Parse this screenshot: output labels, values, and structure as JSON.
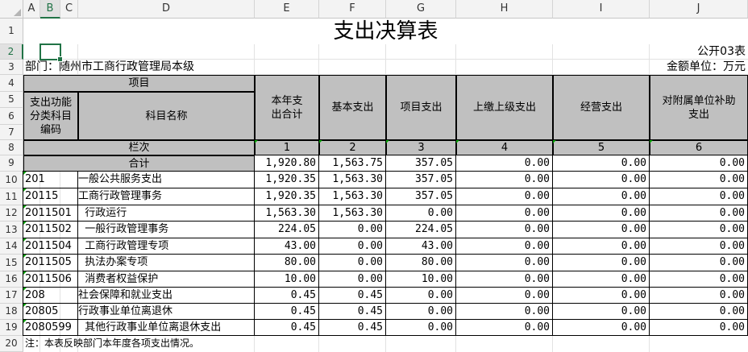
{
  "columns": [
    "A",
    "B",
    "C",
    "D",
    "E",
    "F",
    "G",
    "H",
    "I",
    "J"
  ],
  "rows": [
    "1",
    "2",
    "3",
    "4",
    "5",
    "6",
    "7",
    "8",
    "9",
    "10",
    "11",
    "12",
    "13",
    "14",
    "15",
    "16",
    "17",
    "18",
    "19",
    "20"
  ],
  "title": "支出决算表",
  "form_no": "公开03表",
  "dept": "部门：随州市工商行政管理局本级",
  "unit": "金额单位：万元",
  "headers": {
    "item": "项目",
    "code": "支出功能分类科目编码",
    "name": "科目名称",
    "total": "本年支出合计",
    "basic": "基本支出",
    "project": "项目支出",
    "upper": "上缴上级支出",
    "business": "经营支出",
    "subsidy": "对附属单位补助支出",
    "seq_label": "栏次",
    "seq": [
      "1",
      "2",
      "3",
      "4",
      "5",
      "6"
    ],
    "sum_label": "合计"
  },
  "total_row": [
    "1,920.80",
    "1,563.75",
    "357.05",
    "0.00",
    "0.00",
    "0.00"
  ],
  "data_rows": [
    {
      "code": "201",
      "name": "一般公共服务支出",
      "vals": [
        "1,920.35",
        "1,563.30",
        "357.05",
        "0.00",
        "0.00",
        "0.00"
      ]
    },
    {
      "code": "20115",
      "name": "工商行政管理事务",
      "vals": [
        "1,920.35",
        "1,563.30",
        "357.05",
        "0.00",
        "0.00",
        "0.00"
      ]
    },
    {
      "code": "2011501",
      "name": "  行政运行",
      "vals": [
        "1,563.30",
        "1,563.30",
        "0.00",
        "0.00",
        "0.00",
        "0.00"
      ]
    },
    {
      "code": "2011502",
      "name": "  一般行政管理事务",
      "vals": [
        "224.05",
        "0.00",
        "224.05",
        "0.00",
        "0.00",
        "0.00"
      ]
    },
    {
      "code": "2011504",
      "name": "  工商行政管理专项",
      "vals": [
        "43.00",
        "0.00",
        "43.00",
        "0.00",
        "0.00",
        "0.00"
      ]
    },
    {
      "code": "2011505",
      "name": "  执法办案专项",
      "vals": [
        "80.00",
        "0.00",
        "80.00",
        "0.00",
        "0.00",
        "0.00"
      ]
    },
    {
      "code": "2011506",
      "name": "  消费者权益保护",
      "vals": [
        "10.00",
        "0.00",
        "10.00",
        "0.00",
        "0.00",
        "0.00"
      ]
    },
    {
      "code": "208",
      "name": "社会保障和就业支出",
      "vals": [
        "0.45",
        "0.45",
        "0.00",
        "0.00",
        "0.00",
        "0.00"
      ]
    },
    {
      "code": "20805",
      "name": "行政事业单位离退休",
      "vals": [
        "0.45",
        "0.45",
        "0.00",
        "0.00",
        "0.00",
        "0.00"
      ]
    },
    {
      "code": "2080599",
      "name": "  其他行政事业单位离退休支出",
      "vals": [
        "0.45",
        "0.45",
        "0.00",
        "0.00",
        "0.00",
        "0.00"
      ]
    }
  ],
  "note": "注：本表反映部门本年度各项支出情况。"
}
